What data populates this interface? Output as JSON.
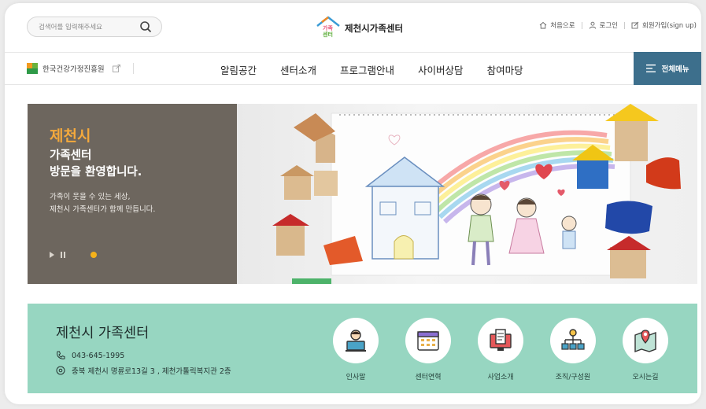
{
  "header": {
    "search": {
      "placeholder": "검색어를 입력해주세요"
    },
    "logo": {
      "name": "제천시가족센터",
      "mark_text_top": "가족",
      "mark_text_bottom": "센터"
    },
    "util": [
      {
        "label": "처음으로",
        "icon": "home-icon"
      },
      {
        "label": "로그인",
        "icon": "user-icon"
      },
      {
        "label": "회원가입(sign up)",
        "icon": "edit-icon"
      }
    ]
  },
  "nav": {
    "gov_link": "한국건강가정진흥원",
    "items": [
      "알림공간",
      "센터소개",
      "프로그램안내",
      "사이버상담",
      "참여마당"
    ],
    "all_menu": "전체메뉴"
  },
  "hero": {
    "title_accent": "제천시",
    "title_line2": "가족센터",
    "title_line3": "방문을 환영합니다.",
    "desc_line1": "가족이 웃을 수 있는 세상,",
    "desc_line2": "제천시 가족센터가 함께 만듭니다.",
    "slides_count": 1,
    "active_slide": 1
  },
  "info": {
    "center_name": "제천시 가족센터",
    "phone": "043-645-1995",
    "address": "충북 제천시 명륜로13길 3 , 제천가톨릭복지관 2층",
    "quick_links": [
      {
        "label": "인사말",
        "icon": "person-computer-icon"
      },
      {
        "label": "센터연혁",
        "icon": "calendar-icon"
      },
      {
        "label": "사업소개",
        "icon": "document-monitor-icon"
      },
      {
        "label": "조직/구성원",
        "icon": "org-chart-icon"
      },
      {
        "label": "오시는길",
        "icon": "map-pin-icon"
      }
    ]
  },
  "colors": {
    "nav_accent": "#3d6f8c",
    "hero_panel": "#6d665e",
    "hero_accent": "#f4a93c",
    "info_band": "#97d6c1",
    "dot_active": "#f5b21a"
  }
}
